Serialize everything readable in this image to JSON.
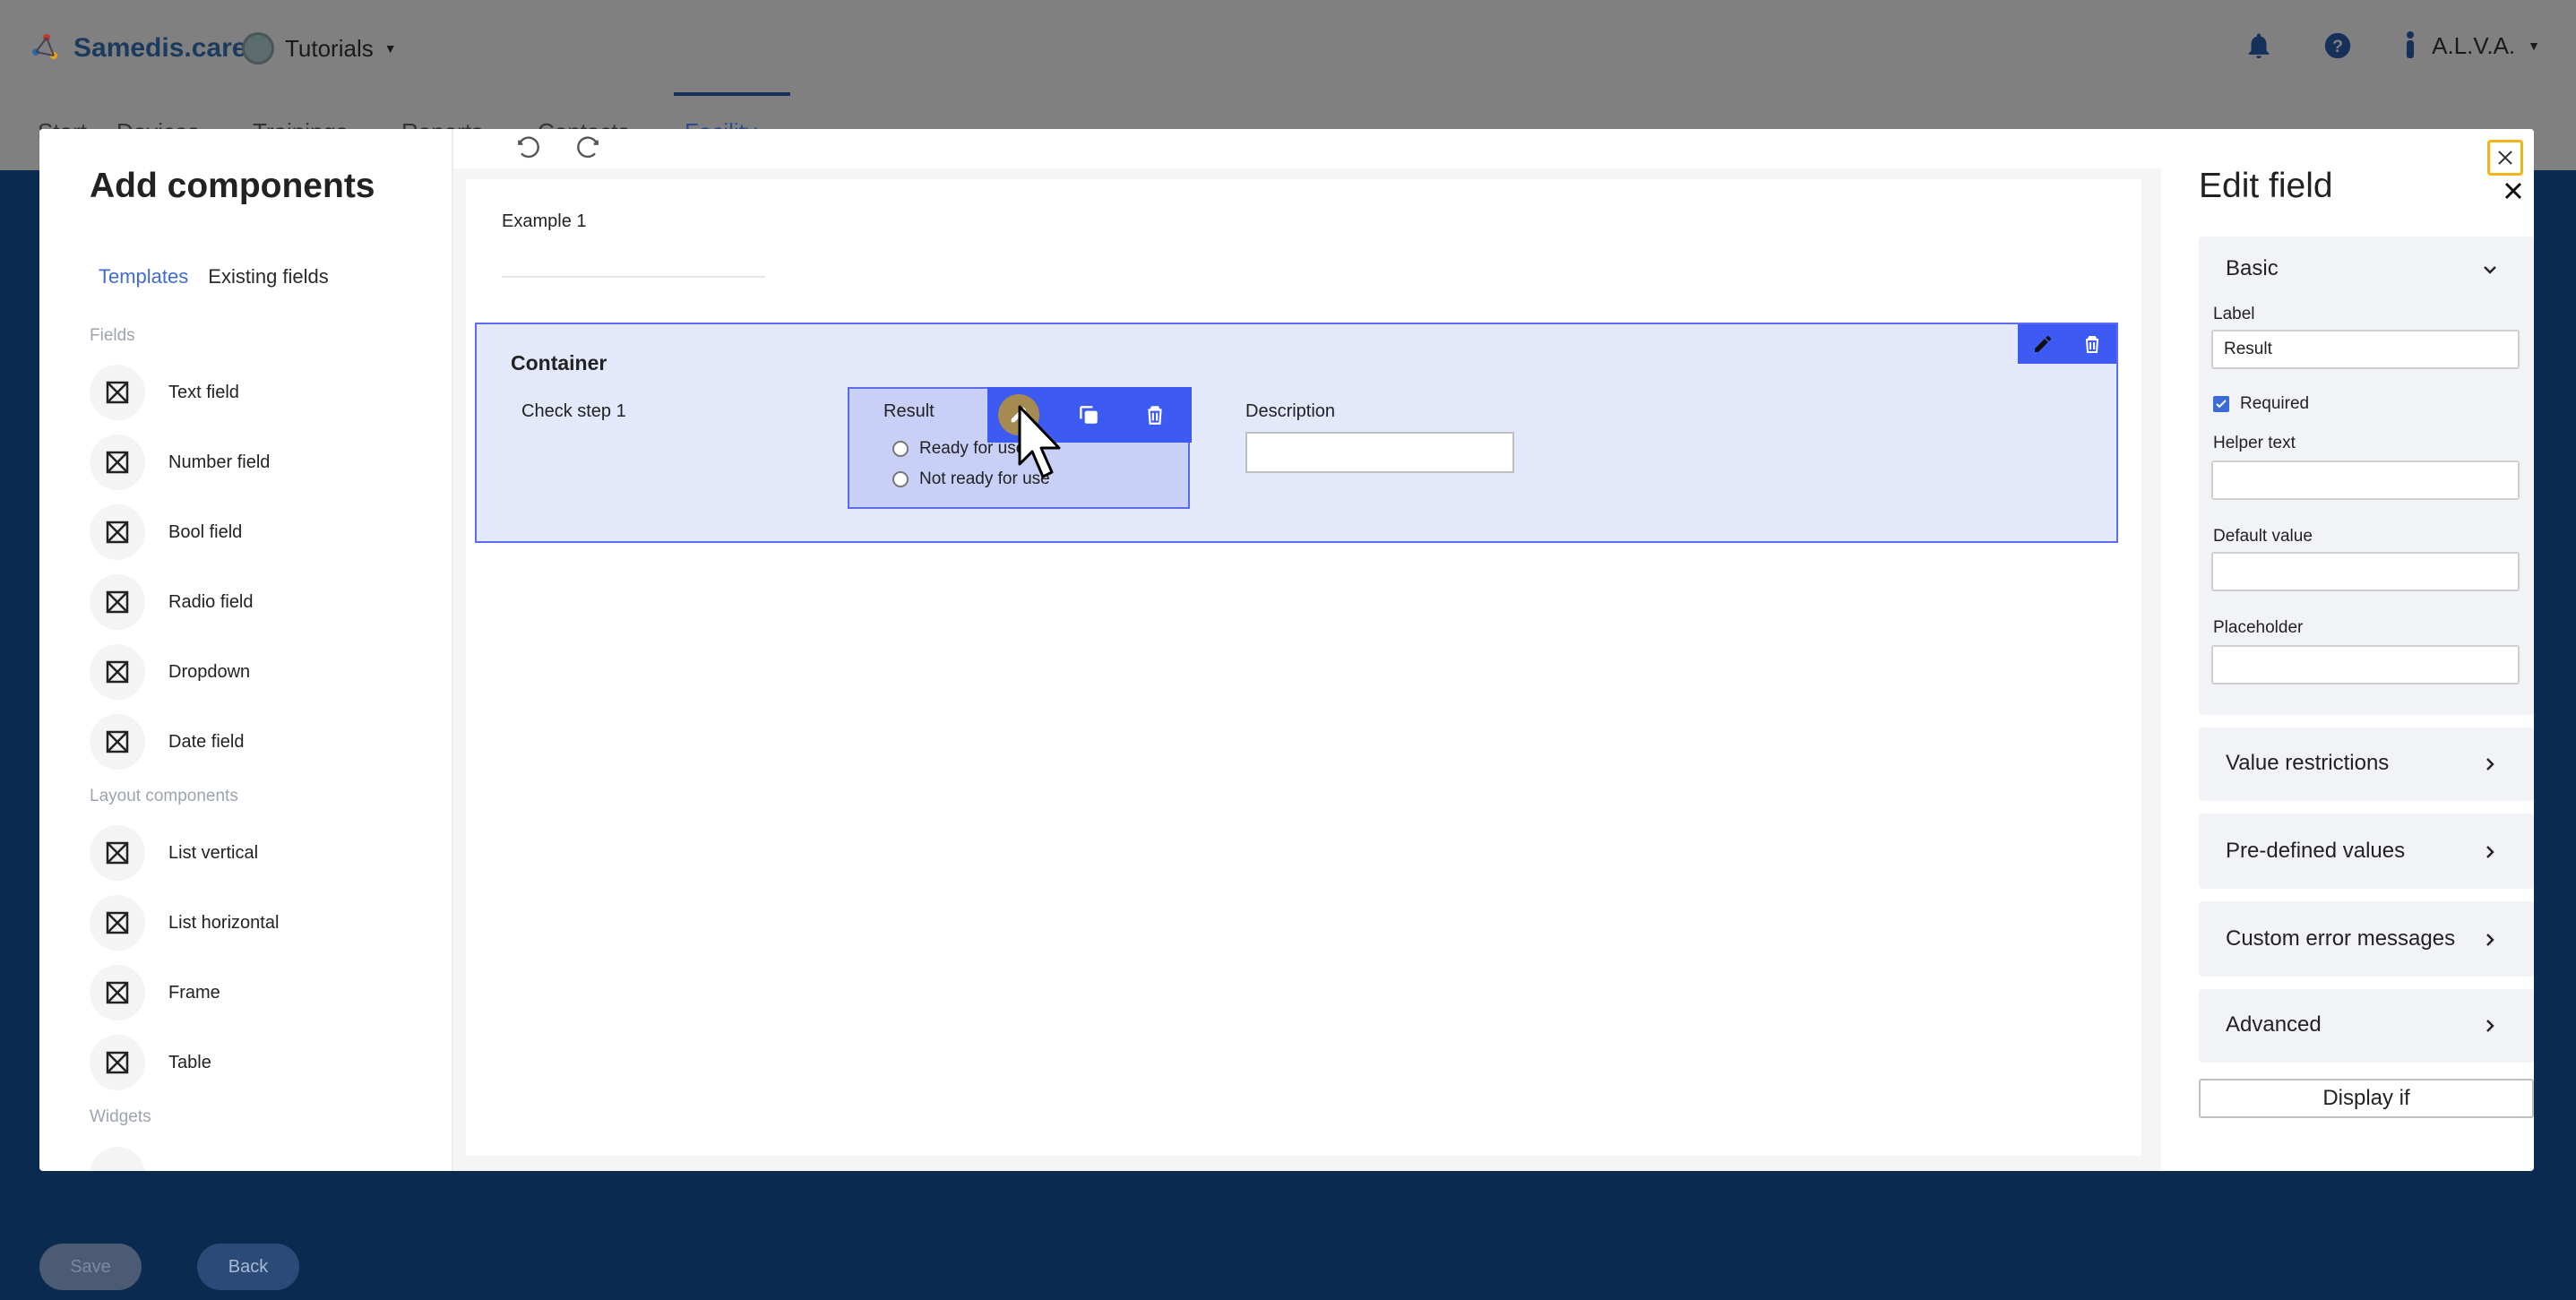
{
  "app": {
    "brand": "Samedis.care",
    "tenant": "Tutorials",
    "user": "A.L.V.A.",
    "tabs": [
      "Start",
      "Devices",
      "Trainings",
      "Reports",
      "Contacts",
      "Facility"
    ],
    "active_tab": "Facility",
    "footer": {
      "save_label": "Save",
      "back_label": "Back"
    }
  },
  "left_panel": {
    "title": "Add components",
    "tabs": {
      "templates": "Templates",
      "existing": "Existing fields"
    },
    "sections": {
      "fields": "Fields",
      "layout": "Layout components",
      "widgets": "Widgets"
    },
    "fields": [
      "Text field",
      "Number field",
      "Bool field",
      "Radio field",
      "Dropdown",
      "Date field"
    ],
    "layout_components": [
      "List vertical",
      "List horizontal",
      "Frame",
      "Table"
    ]
  },
  "canvas": {
    "example_label": "Example 1",
    "container": {
      "title": "Container",
      "check_step": "Check step 1",
      "result": {
        "label": "Result",
        "options": [
          "Ready for use",
          "Not ready for use"
        ]
      },
      "description_label": "Description"
    }
  },
  "right_panel": {
    "title": "Edit field",
    "basic": {
      "header": "Basic",
      "label_caption": "Label",
      "label_value": "Result",
      "required_label": "Required",
      "required_checked": true,
      "helper_text_caption": "Helper text",
      "default_value_caption": "Default value",
      "placeholder_caption": "Placeholder"
    },
    "sections": [
      "Value restrictions",
      "Pre-defined values",
      "Custom error messages",
      "Advanced"
    ],
    "display_if_label": "Display if"
  },
  "colors": {
    "accent": "#3d5af2",
    "container_fill": "#e3e8fb",
    "close_outline": "#f1b418",
    "brand_text": "#1b3b5e"
  }
}
